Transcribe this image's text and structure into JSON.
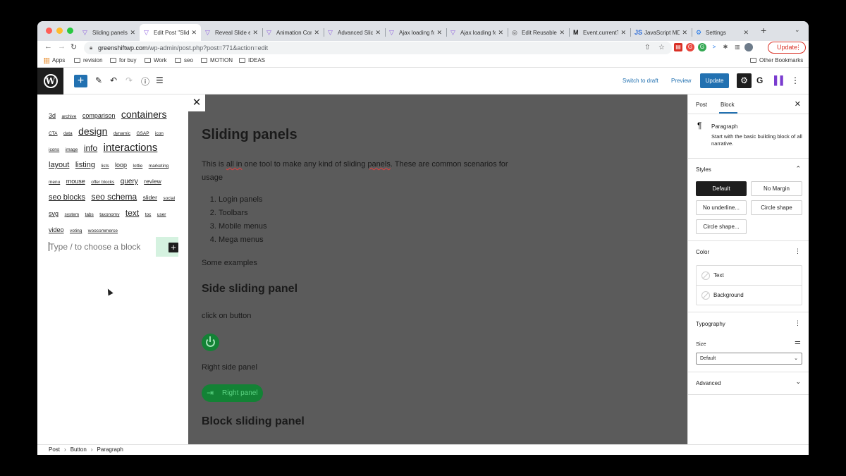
{
  "browser": {
    "tabs": [
      {
        "title": "Sliding panels",
        "active": false
      },
      {
        "title": "Edit Post \"Sliding panels\"",
        "active": true
      },
      {
        "title": "Reveal Slide effect",
        "active": false
      },
      {
        "title": "Animation Controls",
        "active": false
      },
      {
        "title": "Advanced Sliders",
        "active": false
      },
      {
        "title": "Ajax loading for",
        "active": false
      },
      {
        "title": "Ajax loading for",
        "active": false
      },
      {
        "title": "Edit Reusable",
        "active": false
      },
      {
        "title": "Event.currentTarget",
        "active": false
      },
      {
        "title": "JavaScript MDN",
        "active": false
      },
      {
        "title": "Settings",
        "active": false
      }
    ],
    "url_host": "greenshiftwp.com",
    "url_path": "/wp-admin/post.php?post=771&action=edit",
    "update_label": "Update",
    "bookmarks": [
      "Apps",
      "revision",
      "for buy",
      "Work",
      "seo",
      "MOTION",
      "IDEAS"
    ],
    "other_bookmarks": "Other Bookmarks"
  },
  "wp_toolbar": {
    "switch_to_draft": "Switch to draft",
    "preview": "Preview",
    "update": "Update"
  },
  "tag_cloud": [
    {
      "label": "3d",
      "size": 9
    },
    {
      "label": "archive",
      "size": 6.5
    },
    {
      "label": "comparison",
      "size": 9
    },
    {
      "label": "containers",
      "size": 14
    },
    {
      "label": "CTA",
      "size": 6.5
    },
    {
      "label": "data",
      "size": 6.5
    },
    {
      "label": "design",
      "size": 14
    },
    {
      "label": "dynamic",
      "size": 6.5
    },
    {
      "label": "GSAP",
      "size": 6.5
    },
    {
      "label": "icon",
      "size": 6.5
    },
    {
      "label": "icons",
      "size": 6.5
    },
    {
      "label": "image",
      "size": 6.5
    },
    {
      "label": "info",
      "size": 12
    },
    {
      "label": "interactions",
      "size": 15
    },
    {
      "label": "layout",
      "size": 11
    },
    {
      "label": "listing",
      "size": 11
    },
    {
      "label": "lists",
      "size": 6.5
    },
    {
      "label": "loop",
      "size": 9
    },
    {
      "label": "lottie",
      "size": 6.5
    },
    {
      "label": "marketing",
      "size": 6.5
    },
    {
      "label": "menu",
      "size": 6.5
    },
    {
      "label": "mouse",
      "size": 9
    },
    {
      "label": "offer blocks",
      "size": 6.5
    },
    {
      "label": "query",
      "size": 10
    },
    {
      "label": "review",
      "size": 8.5
    },
    {
      "label": "seo blocks",
      "size": 11
    },
    {
      "label": "seo schema",
      "size": 12
    },
    {
      "label": "slider",
      "size": 8.5
    },
    {
      "label": "social",
      "size": 6.5
    },
    {
      "label": "svg",
      "size": 9
    },
    {
      "label": "system",
      "size": 6.5
    },
    {
      "label": "tabs",
      "size": 6.5
    },
    {
      "label": "taxonomy",
      "size": 6.5
    },
    {
      "label": "text",
      "size": 12
    },
    {
      "label": "toc",
      "size": 6.5
    },
    {
      "label": "user",
      "size": 6.5
    },
    {
      "label": "video",
      "size": 9
    },
    {
      "label": "voting",
      "size": 6.5
    },
    {
      "label": "woocommerce",
      "size": 6.5
    }
  ],
  "left_panel": {
    "inserter_placeholder": "Type / to choose a block"
  },
  "editor": {
    "title": "Sliding panels",
    "intro_a": "This is ",
    "intro_sq1": "all in",
    "intro_b": " one tool to make any kind of sliding ",
    "intro_sq2": "panels",
    "intro_c": ". These are common scenarios for usage",
    "list": [
      "Login panels",
      "Toolbars",
      "Mobile menus",
      "Mega menus"
    ],
    "some_examples": "Some examples",
    "h_side": "Side sliding panel",
    "click_on_button": "click on button",
    "right_side_panel": "Right side panel",
    "right_panel_btn": "Right panel",
    "h_block": "Block sliding panel"
  },
  "sidebar": {
    "tab_post": "Post",
    "tab_block": "Block",
    "block_name": "Paragraph",
    "block_desc": "Start with the basic building block of all narrative.",
    "styles_title": "Styles",
    "styles": [
      "Default",
      "No Margin",
      "No underline...",
      "Circle shape",
      "Circle shape..."
    ],
    "color_title": "Color",
    "color_text": "Text",
    "color_background": "Background",
    "typography_title": "Typography",
    "size_label": "Size",
    "size_value": "Default",
    "advanced_title": "Advanced"
  },
  "breadcrumb": [
    "Post",
    "Button",
    "Paragraph"
  ],
  "colors": {
    "wp_blue": "#2271b1",
    "green_button": "#138235",
    "canvas_overlay": "#5b5b5b"
  }
}
